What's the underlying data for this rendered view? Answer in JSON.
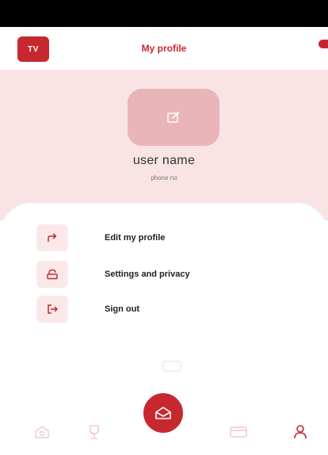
{
  "header": {
    "title": "My profile",
    "logo_text": "TV",
    "logo_icon": "app-logo"
  },
  "profile": {
    "username": "user name",
    "phone": "phone no",
    "avatar_icon": "edit-icon"
  },
  "menu": {
    "items": [
      {
        "label": "Edit my profile",
        "icon": "share-arrow-icon"
      },
      {
        "label": "Settings and privacy",
        "icon": "lock-icon"
      },
      {
        "label": "Sign out",
        "icon": "sign-out-icon"
      }
    ]
  },
  "bottom_nav": {
    "items": [
      {
        "icon": "home-icon"
      },
      {
        "icon": "trophy-icon"
      },
      {
        "icon": "envelope-icon",
        "active_fab": true
      },
      {
        "icon": "card-icon"
      },
      {
        "icon": "user-icon",
        "active": true
      }
    ]
  },
  "colors": {
    "brand": "#c7282f",
    "profile_bg": "#f9e3e4",
    "avatar_bg": "#eab5b9",
    "menu_icon_bg": "#fbe9ea",
    "nav_inactive": "#f0c9cb"
  }
}
